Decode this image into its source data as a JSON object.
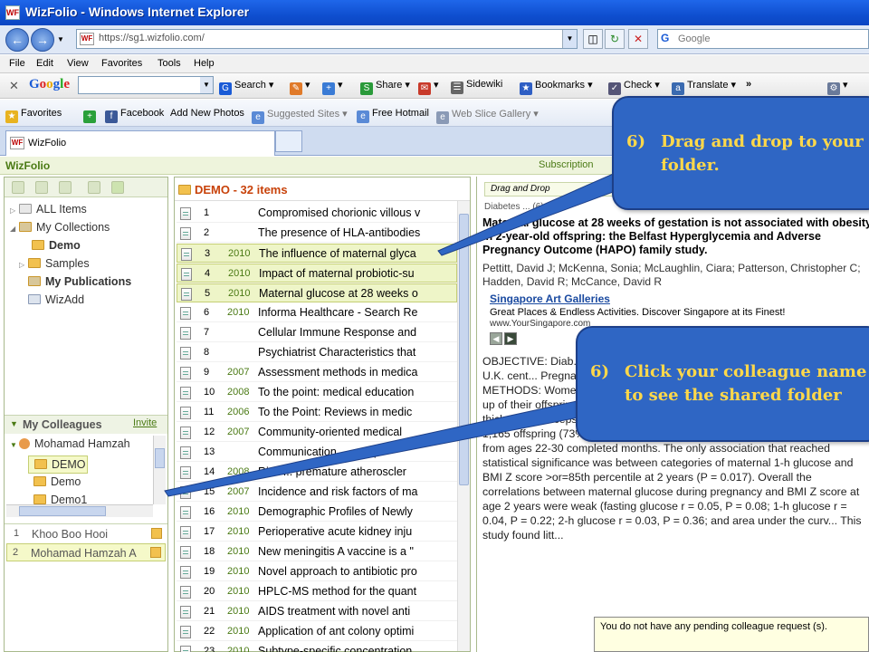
{
  "window": {
    "title": "WizFolio - Windows Internet Explorer",
    "app_icon": "WF"
  },
  "address": {
    "url": "https://sg1.wizfolio.com/",
    "search_placeholder": "Google"
  },
  "menu": [
    "File",
    "Edit",
    "View",
    "Favorites",
    "Tools",
    "Help"
  ],
  "google_toolbar": {
    "logo": "Google",
    "items": [
      "Search",
      "Share",
      "Sidewiki",
      "Bookmarks",
      "Check",
      "Translate"
    ],
    "more": "»"
  },
  "favorites_bar": {
    "favorites": "Favorites",
    "items": [
      "Facebook",
      "Add New Photos",
      "Suggested Sites",
      "Free Hotmail",
      "Web Slice Gallery"
    ]
  },
  "tab": {
    "label": "WizFolio"
  },
  "app": {
    "brand": "WizFolio",
    "subscription": "Subscription"
  },
  "tree": {
    "items": [
      {
        "label": "ALL Items"
      },
      {
        "label": "My Collections"
      },
      {
        "label": "Demo"
      },
      {
        "label": "Samples"
      },
      {
        "label": "My Publications"
      },
      {
        "label": "WizAdd"
      }
    ]
  },
  "colleagues": {
    "title": "My Colleagues",
    "invite": "Invite",
    "tree": [
      "Mohamad Hamzah",
      "DEMO",
      "Demo",
      "Demo1"
    ],
    "list": [
      {
        "num": "1",
        "name": "Khoo Boo Hooi"
      },
      {
        "num": "2",
        "name": "Mohamad Hamzah A"
      }
    ]
  },
  "folder": {
    "title": "DEMO - 32 items",
    "items": [
      {
        "num": "1",
        "year": "",
        "title": "Compromised chorionic villous v"
      },
      {
        "num": "2",
        "year": "",
        "title": "The presence of HLA-antibodies"
      },
      {
        "num": "3",
        "year": "2010",
        "title": "The influence of maternal glyca"
      },
      {
        "num": "4",
        "year": "2010",
        "title": "Impact of maternal probiotic-su"
      },
      {
        "num": "5",
        "year": "2010",
        "title": "Maternal glucose at 28 weeks o"
      },
      {
        "num": "6",
        "year": "2010",
        "title": "Informa Healthcare - Search Re"
      },
      {
        "num": "7",
        "year": "",
        "title": "Cellular Immune Response and"
      },
      {
        "num": "8",
        "year": "",
        "title": "Psychiatrist Characteristics that"
      },
      {
        "num": "9",
        "year": "2007",
        "title": "Assessment methods in medica"
      },
      {
        "num": "10",
        "year": "2008",
        "title": "To the point: medical education"
      },
      {
        "num": "11",
        "year": "2006",
        "title": "To the Point: Reviews in medic"
      },
      {
        "num": "12",
        "year": "2007",
        "title": "Community-oriented medical"
      },
      {
        "num": "13",
        "year": "",
        "title": "Communication ... comp"
      },
      {
        "num": "14",
        "year": "2008",
        "title": "Risk ... premature atheroscler"
      },
      {
        "num": "15",
        "year": "2007",
        "title": "Incidence and risk factors of ma"
      },
      {
        "num": "16",
        "year": "2010",
        "title": "Demographic Profiles of Newly"
      },
      {
        "num": "17",
        "year": "2010",
        "title": "Perioperative acute kidney inju"
      },
      {
        "num": "18",
        "year": "2010",
        "title": "New meningitis A vaccine is a \""
      },
      {
        "num": "19",
        "year": "2010",
        "title": "Novel approach to antibiotic pro"
      },
      {
        "num": "20",
        "year": "2010",
        "title": "HPLC-MS method for the quant"
      },
      {
        "num": "21",
        "year": "2010",
        "title": "AIDS treatment with novel anti"
      },
      {
        "num": "22",
        "year": "2010",
        "title": "Application of ant colony optimi"
      },
      {
        "num": "23",
        "year": "2010",
        "title": "Subtype-specific concentration"
      }
    ]
  },
  "detail": {
    "drag_hint": "Drag and Drop",
    "journal": "Diabetes ... (6): 1219",
    "title": "Maternal glucose at 28 weeks of gestation is not associated with obesity in 2-year-old offspring: the Belfast Hyperglycemia and Adverse Pregnancy Outcome (HAPO) family study.",
    "authors": "Pettitt, David J; McKenna, Sonia; McLaughlin, Ciara; Patterson, Christopher C; Hadden, David R; McCance, David R",
    "ad": {
      "headline": "Singapore Art Galleries",
      "desc": "Great Places & Endless Activities. Discover Singapore at its Finest!",
      "url": "www.YourSingapore.com"
    },
    "abstract": "OBJECTIVE: Diab... obesity in the off... becomes appare... examin... ... Belfast U.K. cent... Pregnancy Outcome (HAPO) Study. RESEARCH DESIGN AND METHODS: Women from the HAPO Study were invited to participate in follow-up of their offspring aged 2 years. Measurements included height, weight, and thickness of triceps, subscapular, and suprailiac skinfolds. RESULTS: A total of 1,165 offspring (73% of eligible children; 598 boys and 567 girls) were seen from ages 22-30 completed months. The only association that reached statistical significance was between categories of maternal 1-h glucose and BMI Z score >or=85th percentile at 2 years (P = 0.017). Overall the correlations between maternal glucose during pregnancy and BMI Z score at age 2 years were weak (fasting glucose r = 0.05, P = 0.08; 1-h glucose r = 0.04, P = 0.22; 2-h glucose r = 0.03, P = 0.36; and area under the curv... This study found litt..."
  },
  "notice": "You do not have any pending colleague request (s).",
  "callouts": [
    {
      "num": "6)",
      "text": "Drag and drop to your folder."
    },
    {
      "num": "6)",
      "text": "Click your colleague name to see the shared folder"
    }
  ]
}
